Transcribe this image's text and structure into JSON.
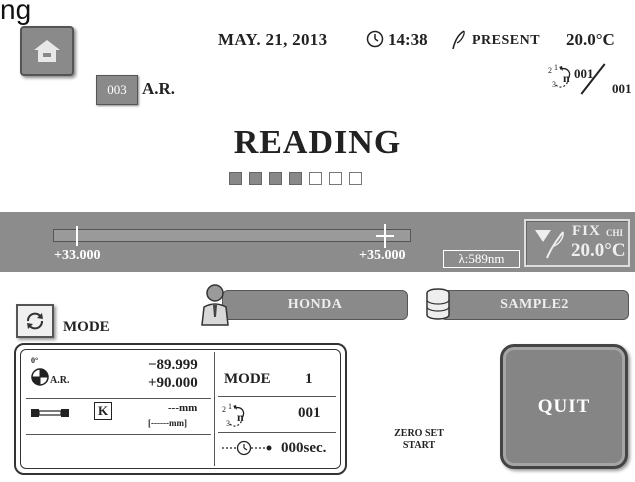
{
  "top_cut_text": "ng",
  "header": {
    "date": "MAY. 21, 2013",
    "time": "14:38",
    "present_label": "PRESENT",
    "temperature": "20.0°C"
  },
  "ar": {
    "code": "003",
    "label": "A.R."
  },
  "counter": {
    "numerator": "001",
    "denominator": "001",
    "icon": "repeat-count-icon"
  },
  "status": {
    "title": "READING",
    "progress_total": 7,
    "progress_filled": 4
  },
  "scale": {
    "left_value": "+33.000",
    "right_value": "+35.000",
    "wavelength": "λ:589nm",
    "fix_label": "FIX",
    "fix_sub": "CHI",
    "fix_temp": "20.0°C"
  },
  "mode_button": {
    "label": "MODE"
  },
  "operator": {
    "name": "HONDA"
  },
  "sample": {
    "name": "SAMPLE2"
  },
  "panel": {
    "angle_top": "0°",
    "ar_label": "A.R.",
    "value_1": "−89.999",
    "value_2": "+90.000",
    "k_label": "K",
    "length_1": "---mm",
    "length_2": "[------mm]",
    "mode_label": "MODE",
    "mode_value": "1",
    "count_value": "001",
    "time_value": "000sec."
  },
  "zero_set": {
    "line1": "ZERO SET",
    "line2": "START"
  },
  "quit_button": {
    "label": "QUIT"
  }
}
